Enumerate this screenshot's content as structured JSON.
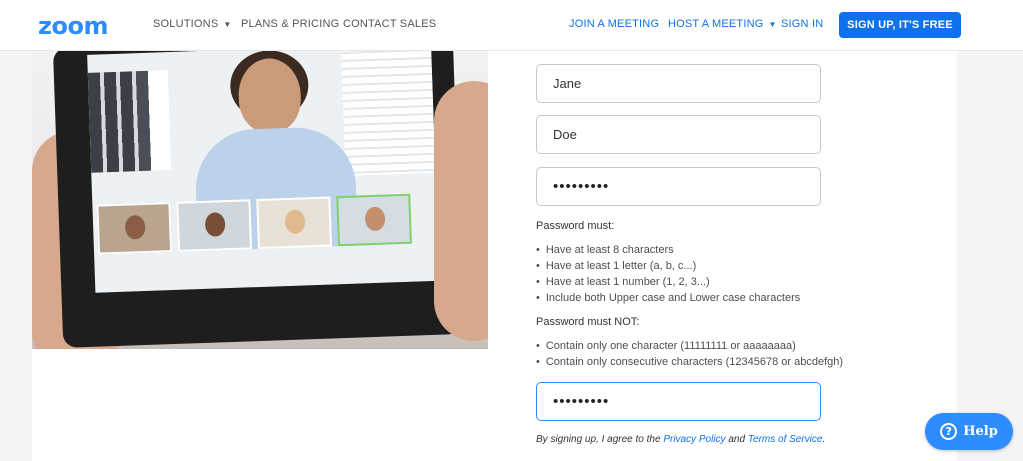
{
  "header": {
    "logo": "zoom",
    "nav_left": [
      {
        "label": "SOLUTIONS",
        "caret": true
      },
      {
        "label": "PLANS & PRICING"
      },
      {
        "label": "CONTACT SALES"
      }
    ],
    "nav_right": [
      {
        "label": "JOIN A MEETING"
      },
      {
        "label": "HOST A MEETING",
        "caret": true
      },
      {
        "label": "SIGN IN"
      }
    ],
    "signup_label": "SIGN UP, IT'S FREE"
  },
  "form": {
    "first_name_value": "Jane",
    "last_name_value": "Doe",
    "password_value": "•••••••••",
    "confirm_password_value": "•••••••••",
    "must_title": "Password must:",
    "must_rules": [
      "Have at least 8 characters",
      "Have at least 1 letter (a, b, c...)",
      "Have at least 1 number (1, 2, 3...)",
      "Include both Upper case and Lower case characters"
    ],
    "must_not_title": "Password must NOT:",
    "must_not_rules": [
      "Contain only one character (11111111 or aaaaaaaa)",
      "Contain only consecutive characters (12345678 or abcdefgh)"
    ],
    "terms_prefix": "By signing up, I agree to the",
    "privacy_link": "Privacy Policy",
    "terms_and": "and",
    "terms_link": "Terms of Service",
    "terms_suffix": "."
  },
  "help": {
    "label": "Help",
    "icon": "question-icon"
  },
  "colors": {
    "brand": "#2d8cff",
    "link": "#0e72ed",
    "button": "#0e72ed"
  }
}
